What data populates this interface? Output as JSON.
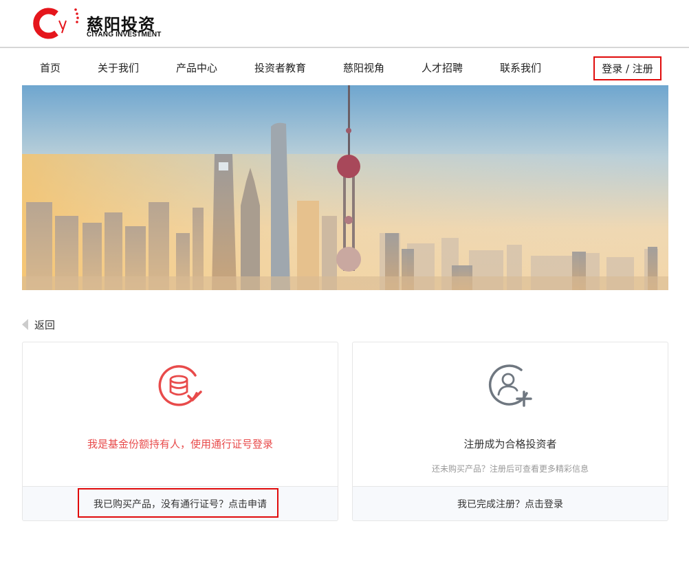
{
  "brand": {
    "name_cn": "慈阳投资",
    "name_en": "CIYANG INVESTMENT",
    "colors": {
      "red": "#e5161c",
      "accent_red": "#e84b4b",
      "gray_icon": "#6f7780"
    }
  },
  "nav": {
    "items": [
      {
        "label": "首页"
      },
      {
        "label": "关于我们"
      },
      {
        "label": "产品中心"
      },
      {
        "label": "投资者教育"
      },
      {
        "label": "慈阳视角"
      },
      {
        "label": "人才招聘"
      },
      {
        "label": "联系我们"
      }
    ],
    "login_label": "登录 / 注册"
  },
  "banner": {
    "icon": "city-skyline-image"
  },
  "back": {
    "label": "返回",
    "icon": "triangle-left-icon"
  },
  "cards": {
    "holder": {
      "icon": "coins-check-icon",
      "title": "我是基金份额持有人，使用通行证号登录",
      "footer": "我已购买产品，没有通行证号？点击申请",
      "title_color": "#e84b4b"
    },
    "register": {
      "icon": "user-add-icon",
      "title": "注册成为合格投资者",
      "subtitle": "还未购买产品？注册后可查看更多精彩信息",
      "footer": "我已完成注册？点击登录"
    }
  }
}
